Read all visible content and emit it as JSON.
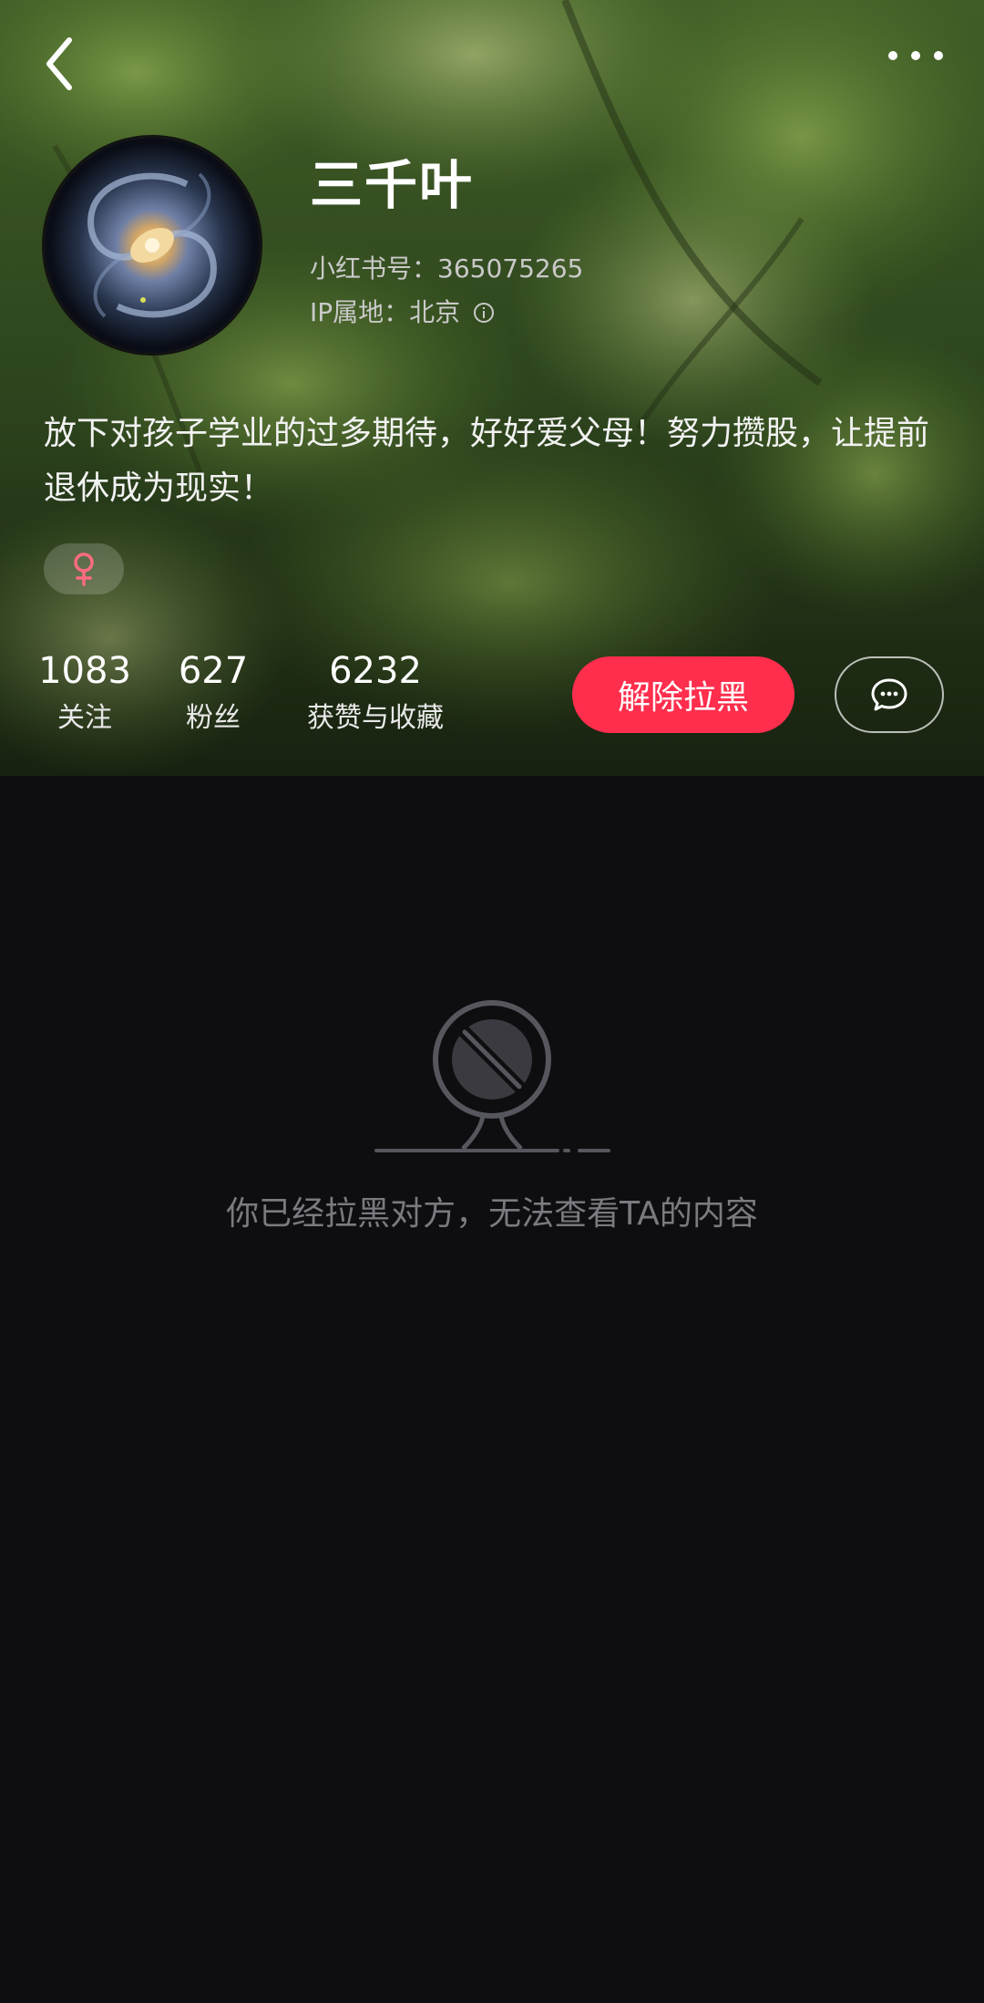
{
  "header": {
    "back_icon": "chevron-left-icon",
    "more_icon": "more-dots-icon"
  },
  "profile": {
    "name": "三千叶",
    "id_text": "小红书号：365075265",
    "ip_text": "IP属地：北京",
    "bio": "放下对孩子学业的过多期待，好好爱父母！努力攒股，让提前退休成为现实！",
    "gender_symbol": "♀"
  },
  "stats": [
    {
      "value": "1083",
      "label": "关注"
    },
    {
      "value": "627",
      "label": "粉丝"
    },
    {
      "value": "6232",
      "label": "获赞与收藏"
    }
  ],
  "actions": {
    "unblock_label": "解除拉黑",
    "message_icon": "chat-bubble-icon"
  },
  "content": {
    "blocked_message": "你已经拉黑对方，无法查看TA的内容"
  },
  "colors": {
    "accent": "#ff2e4d",
    "background": "#0e0e11",
    "muted_text": "#7a7a80",
    "gender_color": "#ff6b81"
  }
}
